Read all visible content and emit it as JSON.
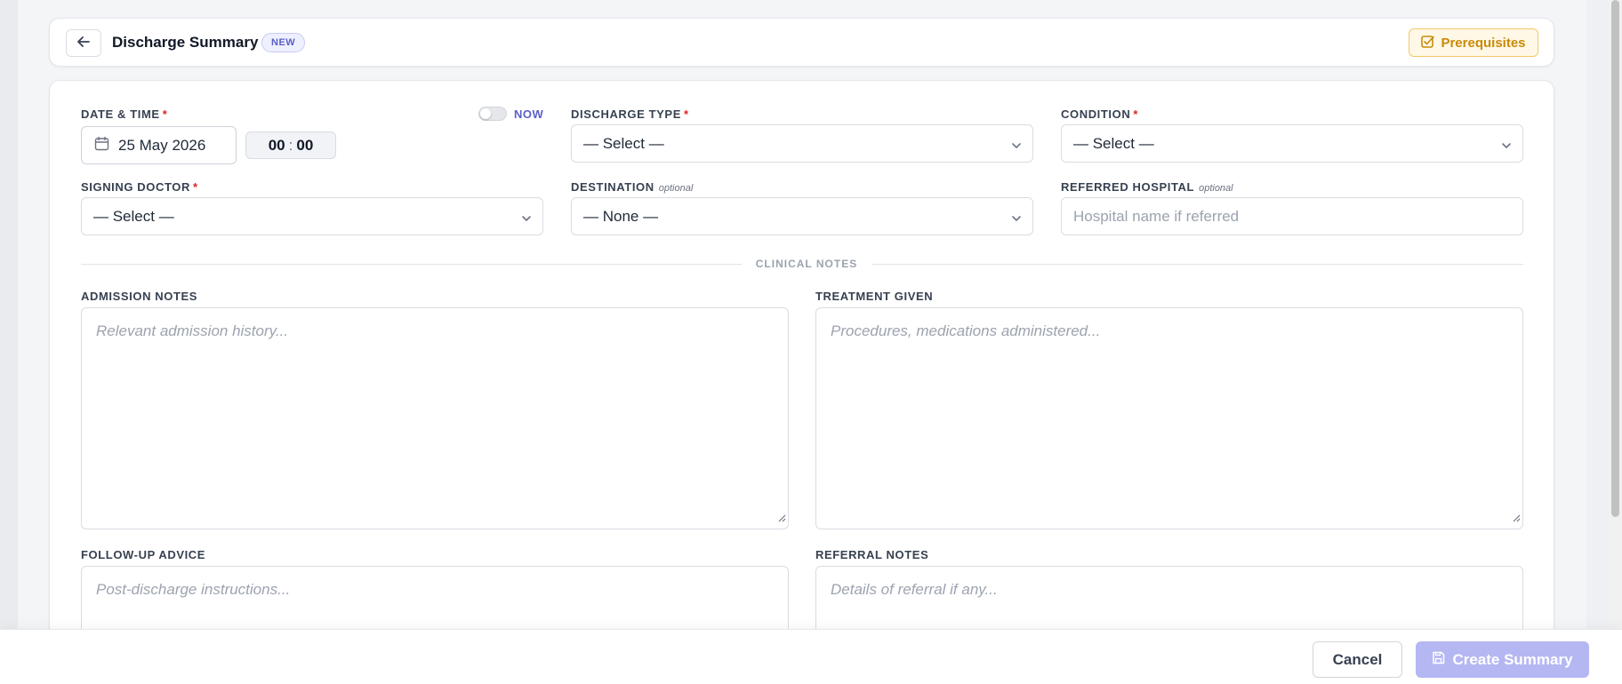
{
  "header": {
    "title": "Discharge Summary",
    "badge": "NEW",
    "prerequisites_label": "Prerequisites"
  },
  "form": {
    "date_time": {
      "label": "DATE & TIME",
      "required_mark": "*",
      "date": "25 May 2026",
      "hours": "00",
      "separator": ":",
      "minutes": "00",
      "now_label": "NOW",
      "now_toggle_on": false
    },
    "discharge_type": {
      "label": "DISCHARGE TYPE",
      "required_mark": "*",
      "value": "— Select —"
    },
    "condition": {
      "label": "CONDITION",
      "required_mark": "*",
      "value": "— Select —"
    },
    "signing_doctor": {
      "label": "SIGNING DOCTOR",
      "required_mark": "*",
      "value": "— Select —"
    },
    "destination": {
      "label": "DESTINATION",
      "optional": "optional",
      "value": "— None —"
    },
    "referred_hospital": {
      "label": "REFERRED HOSPITAL",
      "optional": "optional",
      "placeholder": "Hospital name if referred"
    },
    "section_divider": "CLINICAL NOTES",
    "admission_notes": {
      "label": "ADMISSION NOTES",
      "placeholder": "Relevant admission history..."
    },
    "treatment_given": {
      "label": "TREATMENT GIVEN",
      "placeholder": "Procedures, medications administered..."
    },
    "follow_up_advice": {
      "label": "FOLLOW-UP ADVICE",
      "placeholder": "Post-discharge instructions..."
    },
    "referral_notes": {
      "label": "REFERRAL NOTES",
      "placeholder": "Details of referral if any..."
    }
  },
  "footer": {
    "cancel_label": "Cancel",
    "create_label": "Create Summary"
  },
  "colors": {
    "accent": "#5b5fc7",
    "required": "#dc2626",
    "prerequisites": "#c98a09",
    "create_disabled": "#b5b7f3"
  },
  "icons": [
    "back-arrow-icon",
    "checklist-icon",
    "calendar-icon",
    "chevron-down-icon",
    "resize-grip-icon",
    "save-icon"
  ]
}
